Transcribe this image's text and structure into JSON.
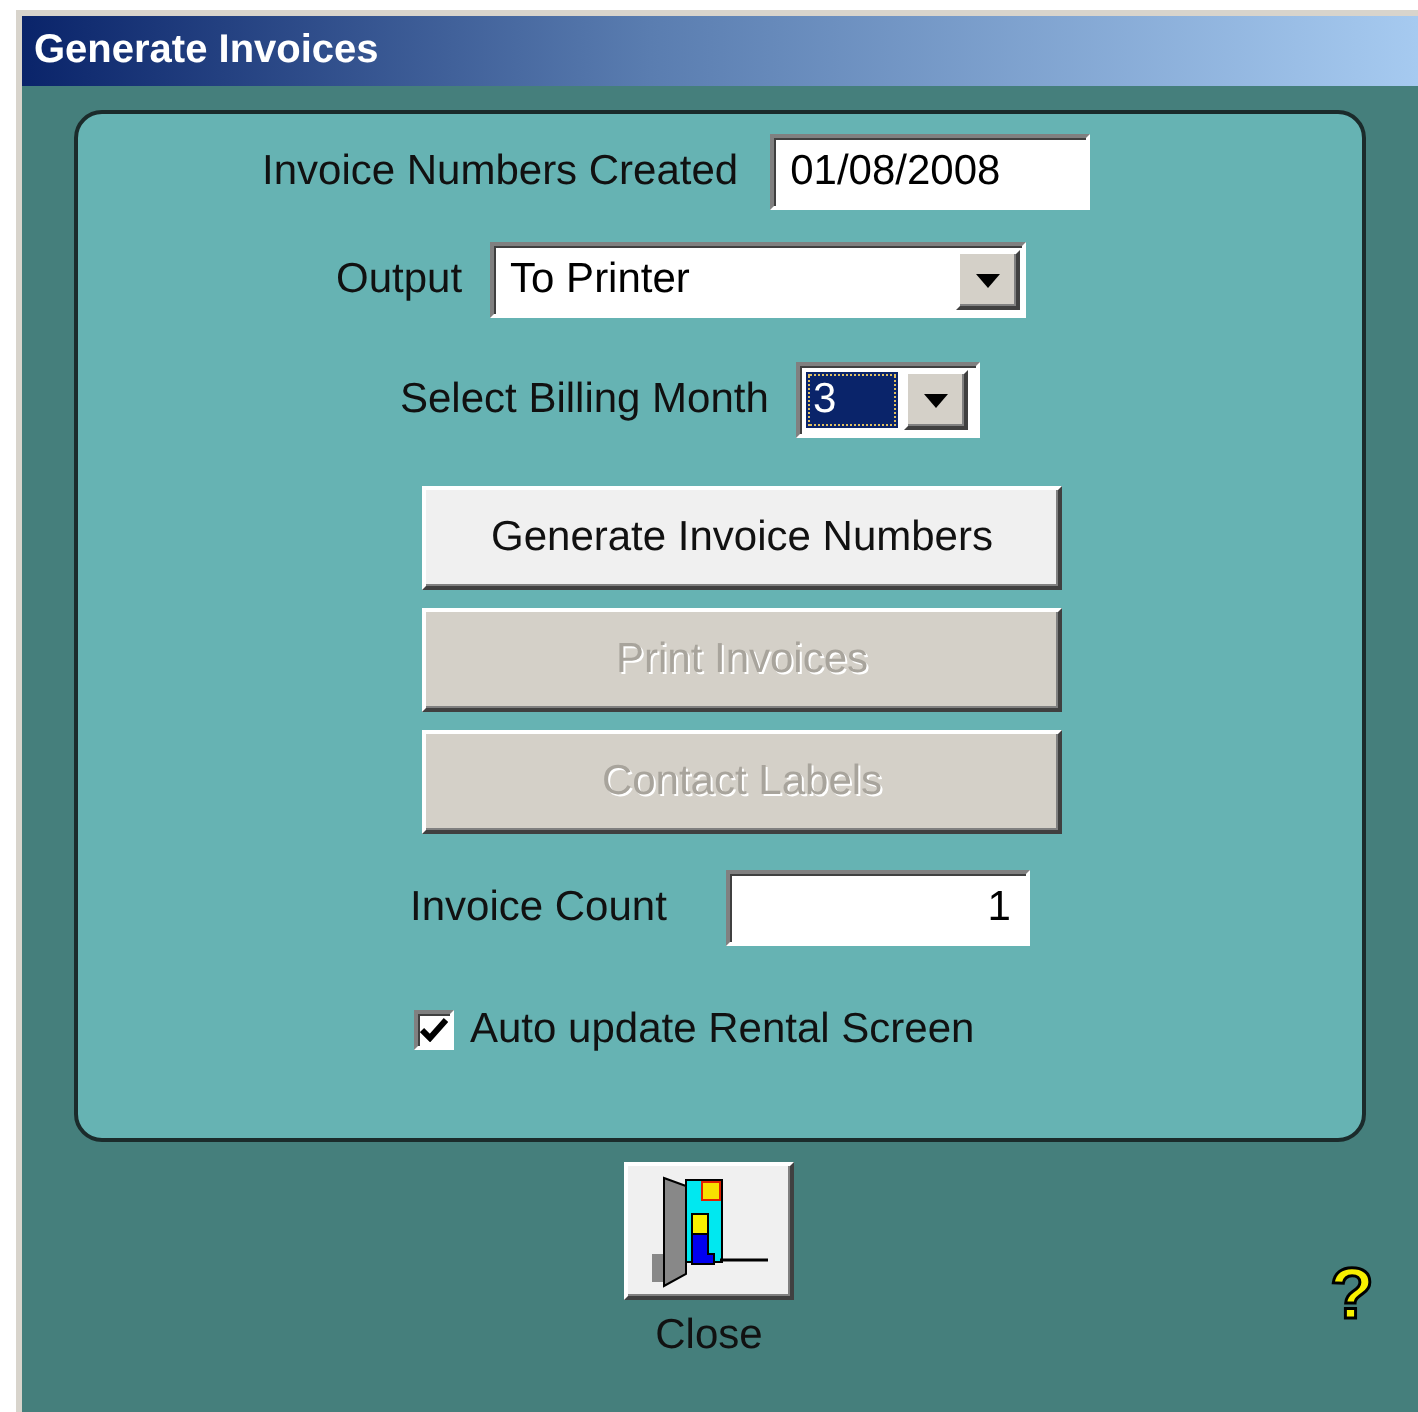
{
  "window": {
    "title": "Generate Invoices"
  },
  "fields": [
    {
      "kind": "text",
      "label": "Invoice Numbers Created",
      "value": "01/08/2008",
      "focused": false
    },
    {
      "kind": "dropdown",
      "label": "Output",
      "value": "To Printer",
      "focused": false
    },
    {
      "kind": "dropdown",
      "label": "Select Billing Month",
      "value": "3",
      "focused": true
    }
  ],
  "buttons": [
    {
      "label": "Generate Invoice Numbers",
      "disabled": false
    },
    {
      "label": "Print Invoices",
      "disabled": true
    },
    {
      "label": "Contact Labels",
      "disabled": true
    }
  ],
  "invoice_count": {
    "label": "Invoice Count",
    "value": "1"
  },
  "auto_update": {
    "label": "Auto update Rental Screen",
    "checked": true
  },
  "close_button": {
    "label": "Close"
  },
  "help": {
    "symbol": "?"
  }
}
